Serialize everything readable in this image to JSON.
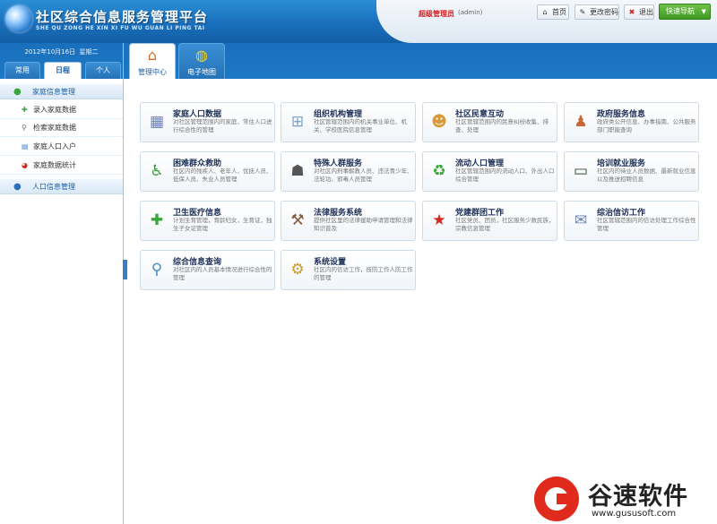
{
  "header": {
    "title": "社区综合信息服务管理平台",
    "subtitle": "SHE QU ZONG HE XIN XI FU WU GUAN LI PING TAI",
    "user_role": "超级管理员",
    "user_name": "(admin)",
    "home_label": "首页",
    "change_password_label": "更改密码",
    "exit_label": "退出",
    "quick_nav_label": "快速导航"
  },
  "sidebar": {
    "date": "2012年10月16日",
    "weekday": "星期二",
    "tabs": [
      "常用",
      "日程",
      "个人"
    ],
    "groups": [
      {
        "label": "家庭信息管理",
        "items": [
          "录入家庭数据",
          "检索家庭数据",
          "家庭人口入户",
          "家庭数据统计"
        ]
      },
      {
        "label": "人口信息管理"
      }
    ]
  },
  "main_tabs": [
    {
      "label": "管理中心",
      "icon": "home-icon"
    },
    {
      "label": "电子地图",
      "icon": "globe-icon"
    }
  ],
  "modules": [
    {
      "title": "家庭人口数据",
      "desc": "对社区管理范围内的家庭、常住人口进行综合性的管理",
      "icon": "database-icon",
      "color": "#6b7fb8"
    },
    {
      "title": "组织机构管理",
      "desc": "社区管辖范围内的机关事业单位、机关、学校医院信息管理",
      "icon": "org-chart-icon",
      "color": "#7aa3c9"
    },
    {
      "title": "社区民意互动",
      "desc": "社区管辖范围内的民意纠纷收集、排查、处理",
      "icon": "people-icon",
      "color": "#d99a3a"
    },
    {
      "title": "政府服务信息",
      "desc": "政府类公开信息、办事指南、公共服务部门职能查询",
      "icon": "official-icon",
      "color": "#c9673b"
    },
    {
      "title": "困难群众救助",
      "desc": "社区内的残疾人、老年人、优抚人员、低保人员、失业人员管理",
      "icon": "wheelchair-icon",
      "color": "#3a9a3a"
    },
    {
      "title": "特殊人群服务",
      "desc": "对社区内刑事解教人员、违法青少年、法轮功、邪毒人员管理",
      "icon": "group-icon",
      "color": "#555555"
    },
    {
      "title": "流动人口管理",
      "desc": "社区管辖范围内的流动人口、外出人口综合管理",
      "icon": "recycle-icon",
      "color": "#3aa63a"
    },
    {
      "title": "培训就业服务",
      "desc": "社区内的待业人员数据、最新就业信息以及推送招聘信息",
      "icon": "blackboard-icon",
      "color": "#2f4a2f"
    },
    {
      "title": "卫生医疗信息",
      "desc": "计划生育管理，育龄妇女，生育证，独生子女证管理",
      "icon": "medical-cross-icon",
      "color": "#3aa63a"
    },
    {
      "title": "法律服务系统",
      "desc": "提供社区里的法律援助申请管理和法律知识普及",
      "icon": "gavel-icon",
      "color": "#8a5a3a"
    },
    {
      "title": "党建群团工作",
      "desc": "社区党员、团员，社区服务少数民族，宗教信息管理",
      "icon": "party-emblem-icon",
      "color": "#d4261c"
    },
    {
      "title": "综治信访工作",
      "desc": "社区管辖范围内的信访处理工作综合性管理",
      "icon": "message-icon",
      "color": "#6b7fb8"
    },
    {
      "title": "综合信息查询",
      "desc": "对社区内的人员基本情况进行综合性的管理",
      "icon": "search-chart-icon",
      "color": "#4a8ac9"
    },
    {
      "title": "系统设置",
      "desc": "社区内的信访工作，技防工作人防工作的管理",
      "icon": "settings-icon",
      "color": "#c99a2a"
    }
  ],
  "watermark": {
    "brand": "谷速软件",
    "url": "www.gususoft.com"
  }
}
